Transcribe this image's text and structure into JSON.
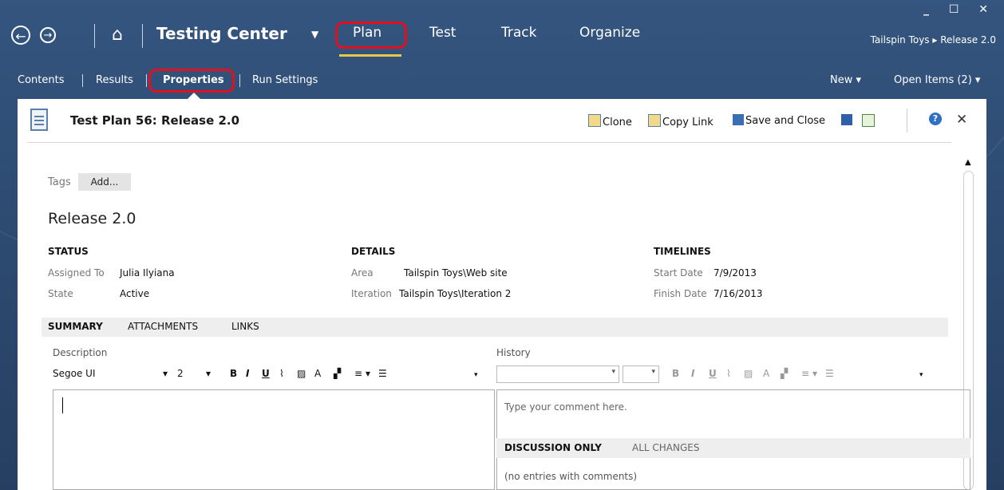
{
  "window_controls": "_ ☐ ✕",
  "nav": {
    "back_glyph": "←",
    "forward_glyph": "→",
    "home_glyph": "⌂",
    "app_title": "Testing Center",
    "app_caret": "▼",
    "tabs": [
      "Plan",
      "Test",
      "Track",
      "Organize"
    ],
    "active_tab": "Plan",
    "breadcrumb": "Tailspin Toys ▸ Release 2.0"
  },
  "subnav": {
    "items": [
      "Contents",
      "Results",
      "Properties",
      "Run Settings"
    ],
    "active": "Properties",
    "new_label": "New ▾",
    "open_items_label": "Open Items (2) ▾"
  },
  "panel": {
    "title": "Test Plan 56: Release 2.0",
    "toolbar": {
      "clone": "Clone",
      "copy_link": "Copy Link",
      "save_close": "Save and Close",
      "help": "?",
      "close": "✕"
    },
    "tags_label": "Tags",
    "tags_add": "Add...",
    "plan_name": "Release 2.0",
    "status": {
      "header": "STATUS",
      "assigned_label": "Assigned To",
      "assigned_value": "Julia Ilyiana",
      "state_label": "State",
      "state_value": "Active"
    },
    "details": {
      "header": "DETAILS",
      "area_label": "Area",
      "area_value": "Tailspin Toys\\Web site",
      "iteration_label": "Iteration",
      "iteration_value": "Tailspin Toys\\Iteration 2"
    },
    "timelines": {
      "header": "TIMELINES",
      "start_label": "Start Date",
      "start_value": "7/9/2013",
      "finish_label": "Finish Date",
      "finish_value": "7/16/2013"
    },
    "tabs": [
      "SUMMARY",
      "ATTACHMENTS",
      "LINKS"
    ],
    "description_label": "Description",
    "editor": {
      "font": "Segoe UI",
      "font_caret": "▾",
      "size": "2",
      "size_caret": "▾",
      "bold": "B",
      "italic": "I",
      "underline": "U",
      "more": "▾"
    },
    "history_label": "History",
    "comment_placeholder": "Type your comment here.",
    "history_tabs": [
      "DISCUSSION ONLY",
      "ALL CHANGES"
    ],
    "no_entries": "(no entries with comments)"
  },
  "colors": {
    "chrome_bg": "#2e4c73",
    "highlight": "#e0101e",
    "plan_underline": "#e8c84a"
  }
}
